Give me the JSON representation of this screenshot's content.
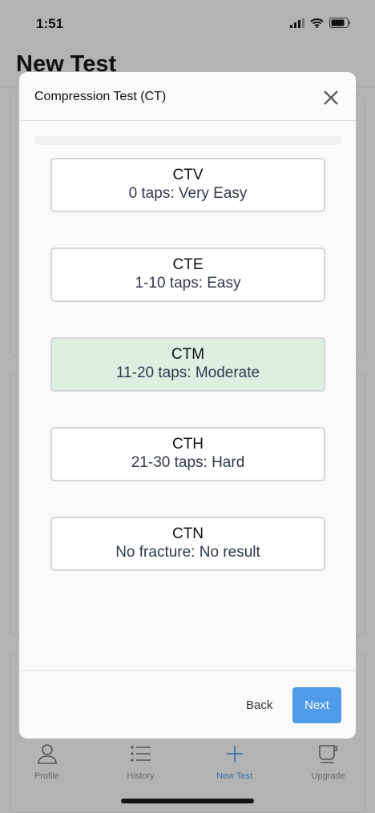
{
  "status_bar": {
    "time": "1:51"
  },
  "page": {
    "title": "New Test"
  },
  "modal": {
    "title": "Compression Test (CT)",
    "progress_percent": 0,
    "options": [
      {
        "code": "CTV",
        "description": "0 taps: Very Easy",
        "selected": false
      },
      {
        "code": "CTE",
        "description": "1-10 taps: Easy",
        "selected": false
      },
      {
        "code": "CTM",
        "description": "11-20 taps: Moderate",
        "selected": true
      },
      {
        "code": "CTH",
        "description": "21-30 taps: Hard",
        "selected": false
      },
      {
        "code": "CTN",
        "description": "No fracture: No result",
        "selected": false
      }
    ],
    "back_label": "Back",
    "next_label": "Next"
  },
  "tabbar": {
    "items": [
      {
        "label": "Profile",
        "icon": "person-icon"
      },
      {
        "label": "History",
        "icon": "list-icon"
      },
      {
        "label": "New Test",
        "icon": "plus-icon",
        "active": true
      },
      {
        "label": "Upgrade",
        "icon": "cup-icon"
      }
    ]
  },
  "colors": {
    "accent": "#4f9ae9",
    "selected": "#dcefe1",
    "active_tab": "#3d73b3"
  }
}
